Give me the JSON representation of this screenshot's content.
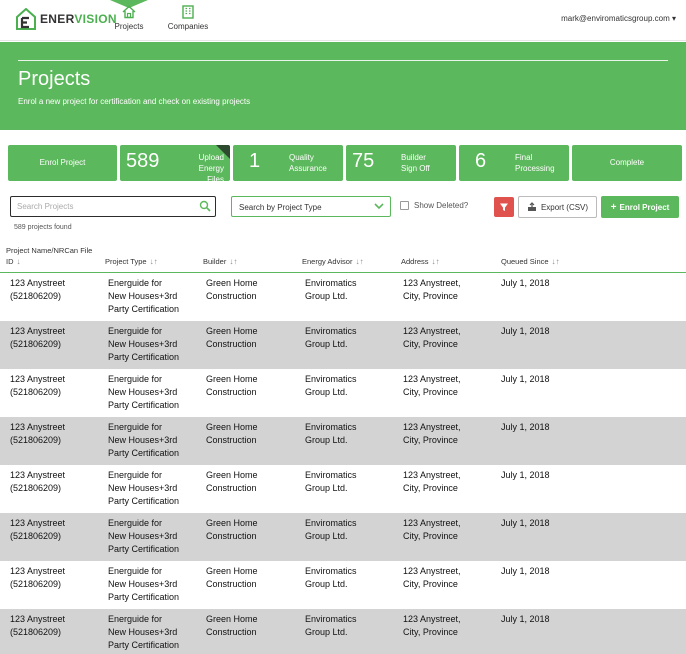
{
  "nav": {
    "logo_ener": "ENER",
    "logo_vision": "VISION",
    "projects_label": "Projects",
    "companies_label": "Companies",
    "user_email": "mark@enviromaticsgroup.com",
    "user_caret": "▾"
  },
  "banner": {
    "title": "Projects",
    "subtitle": "Enrol a new project for certification and check on existing projects"
  },
  "tiles": {
    "enrol": "Enrol Project",
    "upload": {
      "count": "589",
      "label1": "Upload",
      "label2": "Energy Files"
    },
    "qa": {
      "count": "1",
      "label1": "Quality",
      "label2": "Assurance"
    },
    "builder": {
      "count": "75",
      "label1": "Builder",
      "label2": "Sign Off"
    },
    "final": {
      "count": "6",
      "label1": "Final",
      "label2": "Processing"
    },
    "complete": "Complete"
  },
  "filters": {
    "search_placeholder": "Search Projects",
    "found": "589 projects found",
    "type_select": "Search by Project Type",
    "show_deleted": "Show Deleted?",
    "export": "Export (CSV)",
    "enrol": "Enrol Project",
    "enrol_plus": "+"
  },
  "table": {
    "headers": {
      "pname_line1": "Project Name/NRCan File",
      "pname_line2": "ID",
      "type": "Project Type",
      "builder": "Builder",
      "advisor": "Energy Advisor",
      "address": "Address",
      "queued": "Queued Since"
    },
    "sort_glyph": "↓↑",
    "id_sort_glyph": "↓",
    "rows": [
      {
        "id1": "123 Anystreet",
        "id2": "(521806209)",
        "type1": "Energuide for",
        "type2": "New Houses+3rd",
        "type3": "Party Certification",
        "builder1": "Green Home",
        "builder2": "Construction",
        "advisor1": "Enviromatics",
        "advisor2": "Group Ltd.",
        "address1": "123 Anystreet,",
        "address2": "City, Province",
        "queued": "July 1, 2018"
      },
      {
        "id1": "123 Anystreet",
        "id2": "(521806209)",
        "type1": "Energuide for",
        "type2": "New Houses+3rd",
        "type3": "Party Certification",
        "builder1": "Green Home",
        "builder2": "Construction",
        "advisor1": "Enviromatics",
        "advisor2": "Group Ltd.",
        "address1": "123 Anystreet,",
        "address2": "City, Province",
        "queued": "July 1, 2018"
      },
      {
        "id1": "123 Anystreet",
        "id2": "(521806209)",
        "type1": "Energuide for",
        "type2": "New Houses+3rd",
        "type3": "Party Certification",
        "builder1": "Green Home",
        "builder2": "Construction",
        "advisor1": "Enviromatics",
        "advisor2": "Group Ltd.",
        "address1": "123 Anystreet,",
        "address2": "City, Province",
        "queued": "July 1, 2018"
      },
      {
        "id1": "123 Anystreet",
        "id2": "(521806209)",
        "type1": "Energuide for",
        "type2": "New Houses+3rd",
        "type3": "Party Certification",
        "builder1": "Green Home",
        "builder2": "Construction",
        "advisor1": "Enviromatics",
        "advisor2": "Group Ltd.",
        "address1": "123 Anystreet,",
        "address2": "City, Province",
        "queued": "July 1, 2018"
      },
      {
        "id1": "123 Anystreet",
        "id2": "(521806209)",
        "type1": "Energuide for",
        "type2": "New Houses+3rd",
        "type3": "Party Certification",
        "builder1": "Green Home",
        "builder2": "Construction",
        "advisor1": "Enviromatics",
        "advisor2": "Group Ltd.",
        "address1": "123 Anystreet,",
        "address2": "City, Province",
        "queued": "July 1, 2018"
      },
      {
        "id1": "123 Anystreet",
        "id2": "(521806209)",
        "type1": "Energuide for",
        "type2": "New Houses+3rd",
        "type3": "Party Certification",
        "builder1": "Green Home",
        "builder2": "Construction",
        "advisor1": "Enviromatics",
        "advisor2": "Group Ltd.",
        "address1": "123 Anystreet,",
        "address2": "City, Province",
        "queued": "July 1, 2018"
      },
      {
        "id1": "123 Anystreet",
        "id2": "(521806209)",
        "type1": "Energuide for",
        "type2": "New Houses+3rd",
        "type3": "Party Certification",
        "builder1": "Green Home",
        "builder2": "Construction",
        "advisor1": "Enviromatics",
        "advisor2": "Group Ltd.",
        "address1": "123 Anystreet,",
        "address2": "City, Province",
        "queued": "July 1, 2018"
      },
      {
        "id1": "123 Anystreet",
        "id2": "(521806209)",
        "type1": "Energuide for",
        "type2": "New Houses+3rd",
        "type3": "Party Certification",
        "builder1": "Green Home",
        "builder2": "Construction",
        "advisor1": "Enviromatics",
        "advisor2": "Group Ltd.",
        "address1": "123 Anystreet,",
        "address2": "City, Province",
        "queued": "July 1, 2018"
      }
    ]
  },
  "colors": {
    "brand_green": "#5cb85c",
    "alt_row": "#d3d3d3",
    "filter_red": "#e0524e"
  },
  "icons": {
    "logo": "house-e-logo-icon",
    "projects": "house-icon",
    "companies": "building-icon",
    "search": "search-icon",
    "chevron": "chevron-down-icon",
    "filter": "filter-icon",
    "export": "export-icon"
  }
}
